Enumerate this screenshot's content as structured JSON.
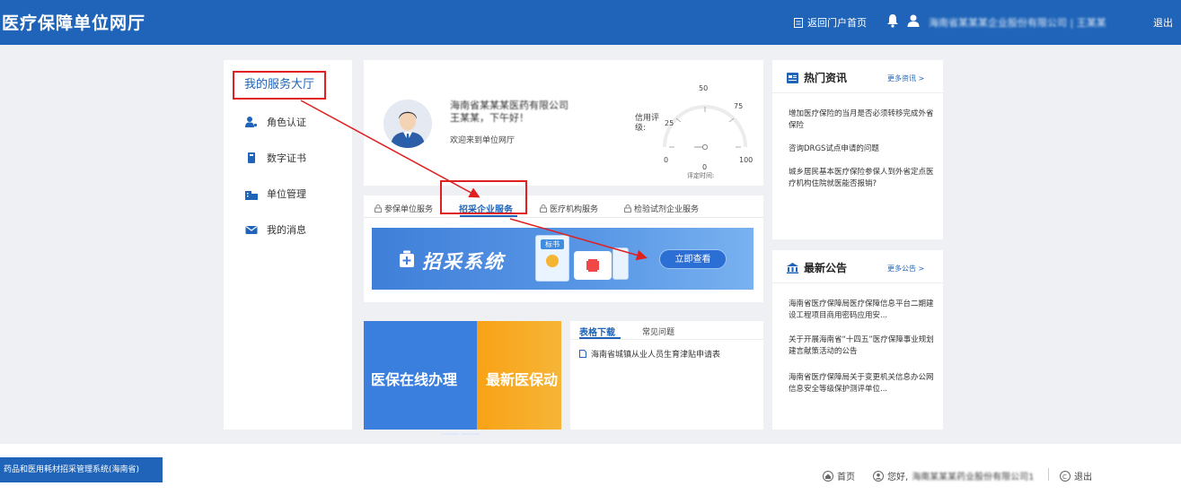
{
  "header": {
    "title": "医疗保障单位网厅",
    "home_label": "返回门户首页",
    "username": "海南省某某某企业股份有限公司 | 王某某",
    "logout_label": "退出"
  },
  "sidebar": {
    "hall_label": "我的服务大厅",
    "items": [
      {
        "label": "角色认证",
        "icon": "user-key-icon"
      },
      {
        "label": "数字证书",
        "icon": "certificate-icon"
      },
      {
        "label": "单位管理",
        "icon": "building-icon"
      },
      {
        "label": "我的消息",
        "icon": "mail-icon"
      }
    ]
  },
  "profile": {
    "company": "海南省某某某医药有限公司",
    "company_line2": "王某某，下午好！",
    "welcome": "欢迎来到单位网厅",
    "credit_label": "信用评级:",
    "gauge_ticks": [
      "0",
      "25",
      "50",
      "75",
      "100"
    ],
    "gauge_value": "0",
    "assess_time_label": "评定时间:"
  },
  "tabs": {
    "items": [
      "参保单位服务",
      "招采企业服务",
      "医疗机构服务",
      "检验试剂企业服务"
    ],
    "active_index": 1
  },
  "banner": {
    "title": "招采系统",
    "doc_label": "标书",
    "view_label": "立即查看"
  },
  "promos": [
    "医保在线办理",
    "最新医保动"
  ],
  "downloads": {
    "tab1": "表格下载",
    "tab2": "常见问题",
    "items": [
      "海南省城镇从业人员生育津贴申请表"
    ]
  },
  "news": {
    "title": "热门资讯",
    "more": "更多资讯 >",
    "items": [
      "增加医疗保险的当月是否必须转移完成外省保险",
      "咨询DRGS试点申请的问题",
      "城乡居民基本医疗保险参保人到外省定点医疗机构住院就医能否报销?"
    ]
  },
  "notices": {
    "title": "最新公告",
    "more": "更多公告 >",
    "items": [
      "海南省医疗保障局医疗保障信息平台二期建设工程项目商用密码应用安...",
      "关于开展海南省“十四五”医疗保障事业规划建言献策活动的公告",
      "海南省医疗保障局关于变更机关信息办公网信息安全等级保护测评单位..."
    ]
  },
  "footer": {
    "system_label": "药品和医用耗材招采管理系统(海南省)",
    "home_label": "首页",
    "greeting": "您好,",
    "company": "海南某某某药业股份有限公司1",
    "logout_label": "退出"
  },
  "colors": {
    "primary": "#1f64b8",
    "highlight_red": "#e02020",
    "promo_orange": "#f8a216"
  }
}
